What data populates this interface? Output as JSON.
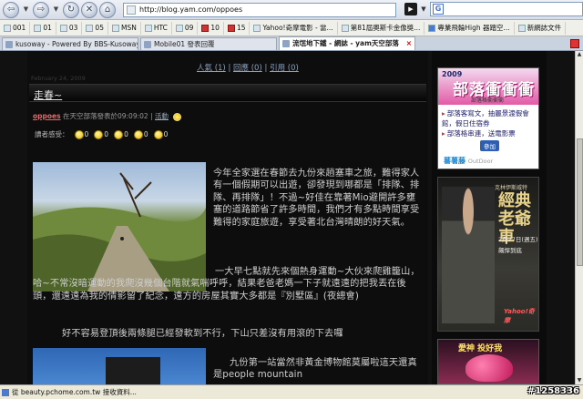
{
  "toolbar": {
    "back": "⇦",
    "forward": "⇨",
    "reload": "↻",
    "stop": "✕",
    "home": "⌂",
    "url": "http://blog.yam.com/oppoes",
    "search_value": ""
  },
  "bookmarks": [
    {
      "label": "001"
    },
    {
      "label": "01"
    },
    {
      "label": "03"
    },
    {
      "label": "05"
    },
    {
      "label": "MSN"
    },
    {
      "label": "HTC"
    },
    {
      "label": "09"
    },
    {
      "label": "10"
    },
    {
      "label": "15"
    },
    {
      "label": "Yahoo!奇摩電影 - 當..."
    },
    {
      "label": "第81屆奧斯卡金像獎..."
    },
    {
      "label": "專業飛輪High 器踏空..."
    },
    {
      "label": "新網誌文件"
    }
  ],
  "tabs": [
    {
      "label": "kusoway - Powered By BBS-Kusoway[...",
      "active": false
    },
    {
      "label": "Mobile01 發表回覆",
      "active": false
    },
    {
      "label": "流氓地下鐵 - 網誌 - yam天空部落",
      "active": true
    }
  ],
  "blog": {
    "nav": {
      "popularity": "人氣 (1)",
      "sep1": "|",
      "replies": "回應 (0)",
      "sep2": "|",
      "trackbacks": "引用 (0)"
    },
    "date": "February 24, 2009",
    "title": "走春~",
    "meta": {
      "author": "oppoes",
      "posted_text": "在天空部落發表於09:09:02",
      "sep": "|",
      "activity": "活動"
    },
    "moods_label": "讀者感受：",
    "moods": [
      "0",
      "0",
      "0",
      "0",
      "0"
    ],
    "paragraphs": [
      "今年全家選在春節去九份來趟塞車之旅，難得家人有一個假期可以出遊，卻發現到哪都是「排隊、排隊、再排隊」！不過~好佳在靠著Mio避開許多壅塞的道路節省了許多時間，我們才有多點時間享受難得的家庭旅遊，享受著北台灣晴朗的好天氣。",
      "一大早七點就先來個熱身運動~大伙來爬雞籠山，哈~不常沒暗運動的我爬沒幾個台階就氣喘呼呼，結果老爸老媽一下子就遠遠的把我丟在後頭，還遠遠為我的倩影留了紀念，遠方的房屋其實大多都是『別墅區』(夜總會)",
      "好不容易登頂後兩條腿已經發軟到不行，下山只差沒有用滾的下去囉",
      "九份第一站當然非黃金博物館莫屬啦這天還真是people mountain"
    ]
  },
  "ads": {
    "ad1": {
      "year": "2009",
      "title": "部落衝衝衝",
      "subtitle": "部落格衝衝衝",
      "link1": "部落客寫文，抽麗景渡假會館，假日住宿券",
      "link2": "部落格串連，送電影票",
      "button": "參加",
      "footer_brand": "蕃薯藤",
      "footer_sub": "OutDoor"
    },
    "ad2": {
      "kicker": "克林伊斯威特",
      "title": "經典老爺車",
      "date": "2月27日(週五)",
      "tagline": "飆悍到底",
      "brand": "Yahoo!奇摩"
    },
    "ad3": {
      "title": "愛神 投好我"
    }
  },
  "statusbar": {
    "text": "從 beauty.pchome.com.tw 接收資料..."
  },
  "watermark": "#1258336"
}
